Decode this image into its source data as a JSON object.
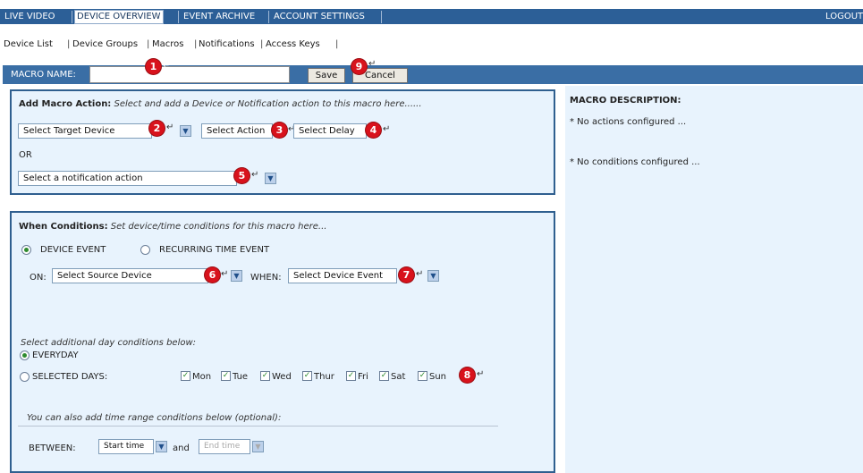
{
  "nav": {
    "tabs": [
      {
        "label": "LIVE VIDEO"
      },
      {
        "label": "DEVICE OVERVIEW"
      },
      {
        "label": "EVENT ARCHIVE"
      },
      {
        "label": "ACCOUNT SETTINGS"
      }
    ],
    "logout": "LOGOUT"
  },
  "subnav": {
    "links": [
      "Device List",
      "Device Groups",
      "Macros",
      "Notifications",
      "Access Keys"
    ]
  },
  "macro": {
    "name_label": "MACRO NAME:",
    "name_value": "",
    "save_label": "Save",
    "cancel_label": "Cancel"
  },
  "action_panel": {
    "title": "Add Macro Action:",
    "hint": "Select and add a Device or Notification action to this macro here......",
    "target_device": "Select Target Device",
    "action": "Select Action",
    "delay": "Select Delay",
    "or_label": "OR",
    "notification": "Select a notification action"
  },
  "conditions_panel": {
    "title": "When Conditions:",
    "hint": "Set device/time conditions for this macro here...",
    "device_event_label": "DEVICE EVENT",
    "recurring_label": "RECURRING TIME EVENT",
    "on_label": "ON:",
    "source_device": "Select Source Device",
    "when_label": "WHEN:",
    "device_event": "Select Device Event",
    "day_hint": "Select additional day conditions below:",
    "everyday_label": "EVERYDAY",
    "selected_days_label": "SELECTED DAYS:",
    "days": [
      "Mon",
      "Tue",
      "Wed",
      "Thur",
      "Fri",
      "Sat",
      "Sun"
    ],
    "time_hint": "You can also add time range conditions below (optional):",
    "between_label": "BETWEEN:",
    "start_time": "Start time",
    "and_label": "and",
    "end_time": "End time"
  },
  "description": {
    "title": "MACRO DESCRIPTION:",
    "actions_line": "* No actions configured ...",
    "conditions_line": "* No conditions configured ..."
  },
  "badges": [
    "1",
    "2",
    "3",
    "4",
    "5",
    "6",
    "7",
    "8",
    "9"
  ],
  "return_glyph": "↵",
  "colors": {
    "nav_bar": "#2c5f97",
    "panel_bg": "#e8f3fd",
    "badge": "#d8121c"
  }
}
